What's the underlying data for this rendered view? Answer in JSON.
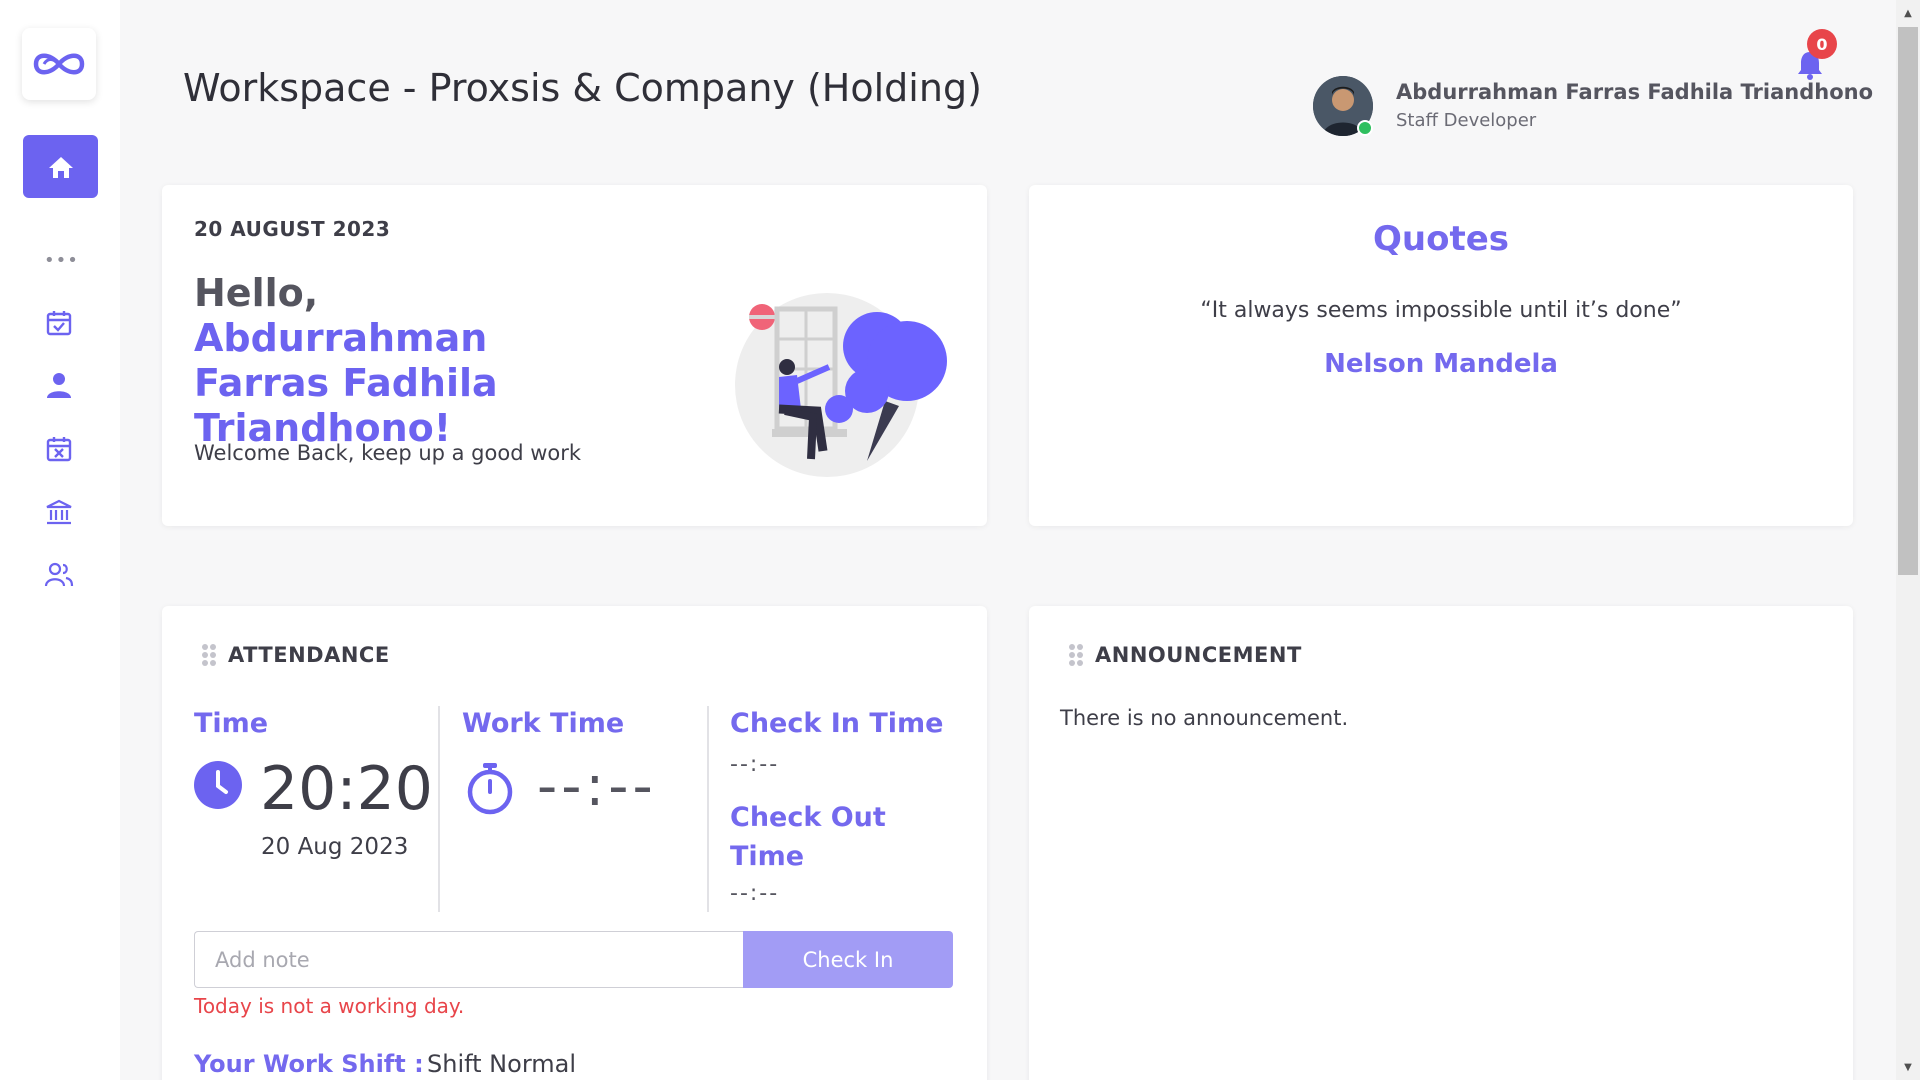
{
  "header": {
    "title": "Workspace - Proxsis & Company (Holding)"
  },
  "profile": {
    "name": "Abdurrahman Farras Fadhila Triandhono",
    "role": "Staff Developer",
    "status_color": "#2fbf5f"
  },
  "notifications": {
    "count": "0"
  },
  "sidebar": {
    "items": [
      {
        "icon": "home-icon",
        "active": true
      },
      {
        "icon": "more-icon"
      },
      {
        "icon": "calendar-check-icon"
      },
      {
        "icon": "user-icon"
      },
      {
        "icon": "calendar-x-icon"
      },
      {
        "icon": "bank-icon"
      },
      {
        "icon": "users-icon"
      }
    ]
  },
  "welcome": {
    "date": "20 AUGUST 2023",
    "greeting": "Hello, ",
    "name": "Abdurrahman Farras Fadhila Triandhono!",
    "subtitle": "Welcome Back, keep up a good work"
  },
  "quotes": {
    "title": "Quotes",
    "text": "“It always seems impossible until it’s done”",
    "author": "Nelson Mandela"
  },
  "attendance": {
    "title": "ATTENDANCE",
    "time_label": "Time",
    "time_value": "20:20",
    "time_date": "20 Aug 2023",
    "work_time_label": "Work Time",
    "work_time_value": "--:--",
    "check_in_label": "Check In Time",
    "check_in_value": "--:--",
    "check_out_label": "Check Out Time",
    "check_out_value": "--:--",
    "note_placeholder": "Add note",
    "check_in_button": "Check In",
    "warning": "Today is not a working day.",
    "shift_label": "Your Work Shift :",
    "shift_value": "Shift Normal"
  },
  "announcement": {
    "title": "ANNOUNCEMENT",
    "empty": "There is no announcement."
  },
  "colors": {
    "accent": "#6c63f0",
    "danger": "#e8454a",
    "button_disabled": "#a29cf5"
  }
}
